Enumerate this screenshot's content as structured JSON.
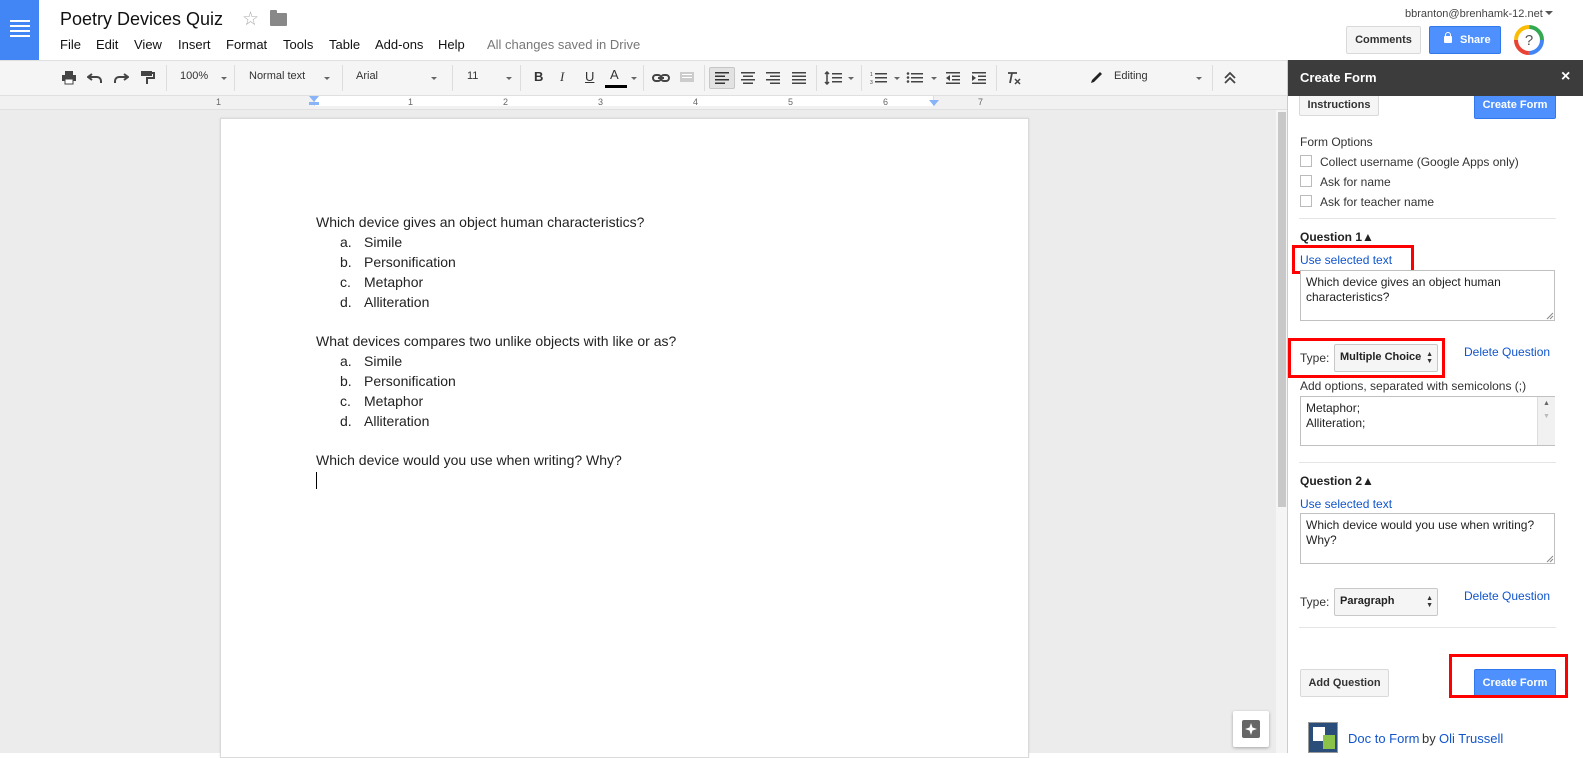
{
  "header": {
    "doc_title": "Poetry Devices Quiz",
    "menu": [
      "File",
      "Edit",
      "View",
      "Insert",
      "Format",
      "Tools",
      "Table",
      "Add-ons",
      "Help"
    ],
    "save_status": "All changes saved in Drive",
    "user_email": "bbranton@brenhamk-12.net",
    "comments_label": "Comments",
    "share_label": "Share",
    "help_glyph": "?"
  },
  "toolbar": {
    "zoom": "100%",
    "style": "Normal text",
    "font": "Arial",
    "font_size": "11",
    "bold": "B",
    "italic": "I",
    "underline": "U",
    "text_color": "A",
    "mode": "Editing"
  },
  "ruler": {
    "numbers": [
      "1",
      "1",
      "2",
      "3",
      "4",
      "5",
      "6",
      "7"
    ]
  },
  "document": {
    "questions": [
      {
        "text": "Which device gives an object human characteristics?",
        "options": [
          {
            "letter": "a.",
            "text": "Simile"
          },
          {
            "letter": "b.",
            "text": "Personification"
          },
          {
            "letter": "c.",
            "text": "Metaphor"
          },
          {
            "letter": "d.",
            "text": "Alliteration"
          }
        ]
      },
      {
        "text": "What devices compares two unlike objects with like or as?",
        "options": [
          {
            "letter": "a.",
            "text": "Simile"
          },
          {
            "letter": "b.",
            "text": "Personification"
          },
          {
            "letter": "c.",
            "text": "Metaphor"
          },
          {
            "letter": "d.",
            "text": "Alliteration"
          }
        ]
      },
      {
        "text": "Which device would you use when writing? Why?",
        "options": []
      }
    ]
  },
  "sidebar": {
    "title": "Create Form",
    "close_glyph": "×",
    "instructions_label": "Instructions",
    "create_form_label": "Create Form",
    "form_options_heading": "Form Options",
    "form_options": [
      "Collect username (Google Apps only)",
      "Ask for name",
      "Ask for teacher name"
    ],
    "question1": {
      "heading": "Question 1▲",
      "use_selected_text": "Use selected text",
      "text": "Which device gives an object human characteristics?",
      "type_label": "Type:",
      "type_value": "Multiple Choice",
      "delete_label": "Delete Question",
      "options_label": "Add options, separated with semicolons (;)",
      "options_value": "Metaphor;\nAlliteration;"
    },
    "question2": {
      "heading": "Question 2▲",
      "use_selected_text": "Use selected text",
      "text": "Which device would you use when writing? Why?",
      "type_label": "Type:",
      "type_value": "Paragraph",
      "delete_label": "Delete Question"
    },
    "add_question_label": "Add Question",
    "create_form_bottom_label": "Create Form",
    "footer_link": "Doc to Form",
    "footer_by": "by",
    "footer_author": "Oli Trussell"
  },
  "colors": {
    "accent_blue": "#4d90fe",
    "doc_blue": "#4285f4",
    "highlight_red": "#ff0000",
    "link_blue": "#1155cc"
  }
}
